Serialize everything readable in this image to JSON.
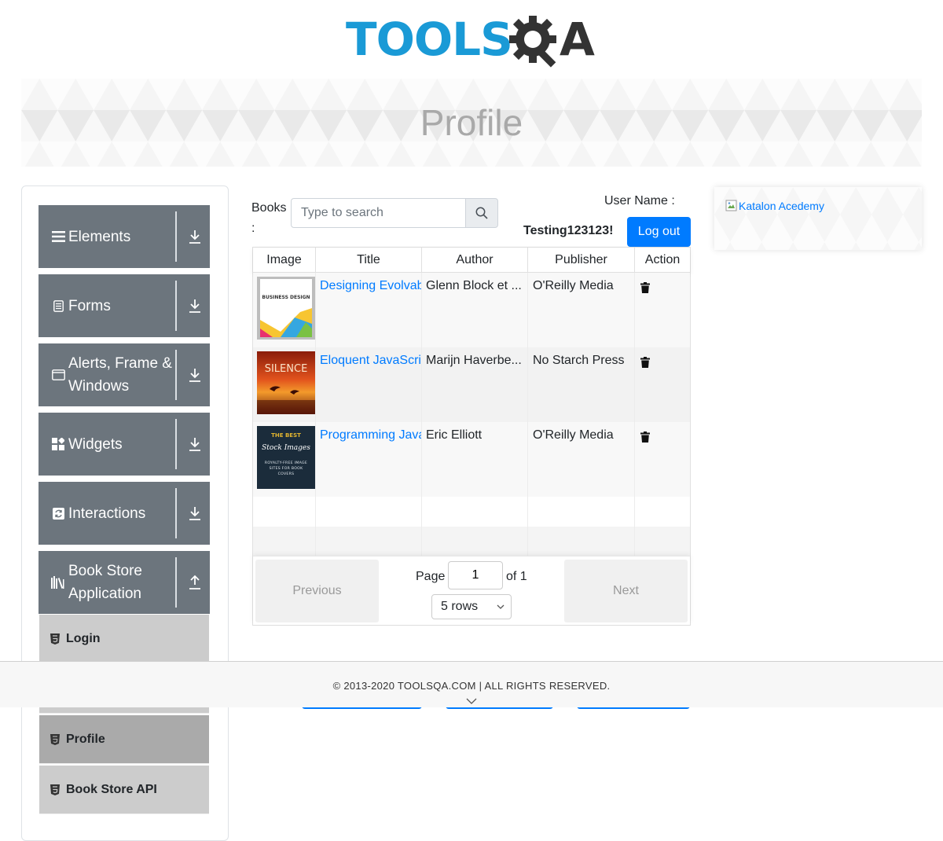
{
  "logo": {
    "part1": "TOOLS",
    "part2": "A"
  },
  "banner": {
    "title": "Profile"
  },
  "sidebar": {
    "groups": [
      {
        "label": "Elements",
        "icon": "menu-icon"
      },
      {
        "label": "Forms",
        "icon": "document-icon"
      },
      {
        "label": "Alerts, Frame & Windows",
        "icon": "window-icon"
      },
      {
        "label": "Widgets",
        "icon": "widgets-icon"
      },
      {
        "label": "Interactions",
        "icon": "interactions-icon"
      },
      {
        "label": "Book Store Application",
        "icon": "books-icon"
      }
    ],
    "book_store_items": [
      {
        "label": "Login",
        "active": false
      },
      {
        "label": "Profile",
        "active": true
      },
      {
        "label": "Book Store API",
        "active": false
      }
    ]
  },
  "books": {
    "label": "Books :",
    "search_placeholder": "Type to search"
  },
  "user": {
    "label": "User Name :",
    "name": "Testing123123!",
    "logout_label": "Log out"
  },
  "table": {
    "columns": [
      "Image",
      "Title",
      "Author",
      "Publisher",
      "Action"
    ],
    "rows": [
      {
        "title": "Designing Evolvable Web APIs with ASP.NET",
        "author": "Glenn Block et ...",
        "publisher": "O'Reilly Media"
      },
      {
        "title": "Eloquent JavaScript, Second Edition",
        "author": "Marijn Haverbe...",
        "publisher": "No Starch Press"
      },
      {
        "title": "Programming JavaScript Applications",
        "author": "Eric Elliott",
        "publisher": "O'Reilly Media"
      }
    ]
  },
  "cover_texts": {
    "book1": "BUSINESS DESIGN",
    "book2": "SILENCE",
    "book3_top": "THE BEST",
    "book3_script": "Stock Images",
    "book3_sub": "ROYALTY-FREE IMAGE SITES FOR BOOK COVERS"
  },
  "pagination": {
    "previous_label": "Previous",
    "next_label": "Next",
    "page_label": "Page",
    "page_value": "1",
    "of_label": "of 1",
    "rows_label": "5 rows"
  },
  "ad": {
    "alt": "Katalon Acedemy"
  },
  "footer": {
    "copyright": "© 2013-2020 TOOLSQA.COM | ALL RIGHTS RESERVED."
  },
  "colors": {
    "brand_blue": "#1a9ad6",
    "primary": "#007bff",
    "sidebar_group": "#6c757d",
    "sidebar_item": "#cccccc",
    "sidebar_active": "#aaaaaa"
  }
}
